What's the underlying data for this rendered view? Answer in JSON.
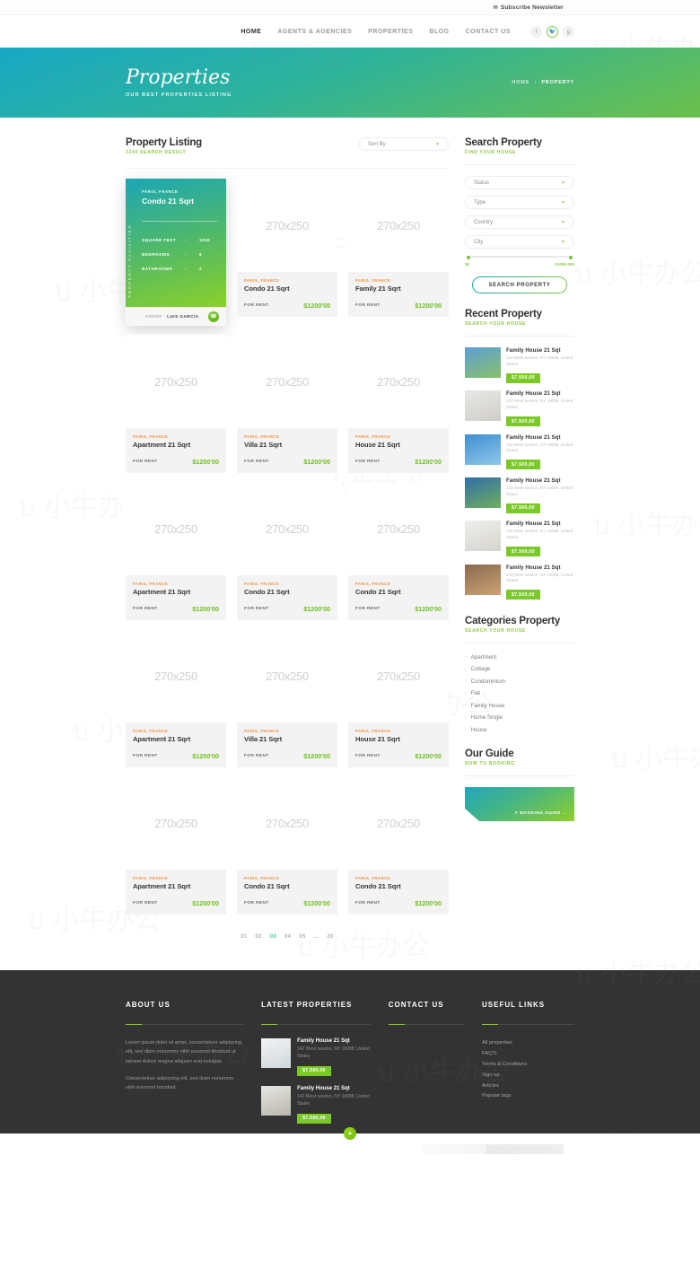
{
  "topbar": {
    "newsletter": "Subscribe Newsletter",
    "mail_icon": "mail-icon"
  },
  "nav": {
    "items": [
      {
        "label": "HOME",
        "active": true
      },
      {
        "label": "AGENTS & AGENCIES",
        "active": false
      },
      {
        "label": "PROPERTIES",
        "active": false
      },
      {
        "label": "BLOG",
        "active": false
      },
      {
        "label": "CONTACT US",
        "active": false
      }
    ],
    "socials": [
      {
        "name": "facebook-icon",
        "glyph": "f",
        "active": false
      },
      {
        "name": "twitter-icon",
        "glyph": "✓",
        "active": true
      },
      {
        "name": "google-plus-icon",
        "glyph": "g",
        "active": false
      }
    ]
  },
  "hero": {
    "title": "Properties",
    "subtitle": "OUR BEST PROPERTIES LISTING",
    "breadcrumb_home": "HOME",
    "breadcrumb_sep": "›",
    "breadcrumb_current": "PROPERTY"
  },
  "listing": {
    "title": "Property Listing",
    "subtitle": "1240 SEARCH RESULT",
    "sort_label": "Sort By",
    "placeholder_text": "270x250",
    "rent_label": "FOR RENT",
    "location": "PARIS, FRANCE",
    "price": "$1200'00",
    "featured": {
      "location": "PARIS, FRANCE",
      "title": "Condo 21 Sqrt",
      "vertical_label": "PROPERTY FACILITIES",
      "facilities": [
        {
          "label": "SQUARE FEET",
          "value": "1200"
        },
        {
          "label": "BEDROOMS",
          "value": "6"
        },
        {
          "label": "BATHROOMS",
          "value": "2"
        }
      ],
      "agent_label": "AGENT :",
      "agent_name": "LUIS GARCIA",
      "phone_icon": "phone-icon"
    },
    "cards": [
      {
        "title": "Condo 21 Sqrt"
      },
      {
        "title": "Family 21 Sqrt"
      },
      {
        "title": "Apartment 21 Sqrt"
      },
      {
        "title": "Villa 21 Sqrt"
      },
      {
        "title": "House 21 Sqrt"
      },
      {
        "title": "Apartment 21 Sqrt"
      },
      {
        "title": "Condo 21 Sqrt"
      },
      {
        "title": "Condo 21 Sqrt"
      },
      {
        "title": "Apartment 21 Sqrt"
      },
      {
        "title": "Villa 21 Sqrt"
      },
      {
        "title": "House 21 Sqrt"
      },
      {
        "title": "Apartment 21 Sqrt"
      },
      {
        "title": "Condo 21 Sqrt"
      },
      {
        "title": "Condo 21 Sqrt"
      }
    ],
    "pagination": [
      {
        "label": "01",
        "active": false
      },
      {
        "label": "02",
        "active": false
      },
      {
        "label": "03",
        "active": true
      },
      {
        "label": "04",
        "active": false
      },
      {
        "label": "05",
        "active": false
      },
      {
        "label": "...",
        "active": false
      },
      {
        "label": "20",
        "active": false
      }
    ]
  },
  "search_property": {
    "title": "Search Property",
    "subtitle": "FIND YOUR HOUSE",
    "fields": [
      {
        "label": "Status"
      },
      {
        "label": "Type"
      },
      {
        "label": "Country"
      },
      {
        "label": "City"
      }
    ],
    "price_min": "$0",
    "price_max": "$1000 000",
    "button": "SEARCH PROPERTY"
  },
  "recent_property": {
    "title": "Recent Property",
    "subtitle": "SEARCH YOUR HOUSE",
    "items": [
      {
        "title": "Family House 21 Sqt",
        "address": "142 West newton, NY 19088, United States",
        "price": "$7.500,00"
      },
      {
        "title": "Family House 21 Sqt",
        "address": "142 West newton, NY 19088, United States",
        "price": "$7.500,00"
      },
      {
        "title": "Family House 21 Sqt",
        "address": "142 West newton, NY 19088, United States",
        "price": "$7.500,00"
      },
      {
        "title": "Family House 21 Sqt",
        "address": "142 West newton, NY 19088, United States",
        "price": "$7.500,00"
      },
      {
        "title": "Family House 21 Sqt",
        "address": "142 West newton, NY 19088, United States",
        "price": "$7.500,00"
      },
      {
        "title": "Family House 21 Sqt",
        "address": "142 West newton, NY 19088, United States",
        "price": "$7.500,00"
      }
    ]
  },
  "categories": {
    "title": "Categories Property",
    "subtitle": "SEARCH YOUR HOUSE",
    "items": [
      {
        "label": "Apartment"
      },
      {
        "label": "Cottage"
      },
      {
        "label": "Condominium"
      },
      {
        "label": "Flat"
      },
      {
        "label": "Family House"
      },
      {
        "label": "Home Single"
      },
      {
        "label": "House"
      }
    ]
  },
  "guide": {
    "title": "Our Guide",
    "subtitle": "HOW TO BOOKING",
    "banner_text": "↗ BOOKING GUIDE →"
  },
  "footer": {
    "about": {
      "heading": "ABOUT US",
      "paragraph1": "Lorem ipsum dolor sit amet, consectetuer adipiscing elit, sed diam nonummy nibh euismod tincidunt ut laoreet dolore magna aliquam erat volutpat.",
      "paragraph2": "Consectetuer adipiscing elit, sed diam nonummy nibh euismod tincidunt"
    },
    "latest": {
      "heading": "LATEST PROPERTIES",
      "items": [
        {
          "title": "Family House 21 Sqt",
          "address": "142 West newton, NY 19088, United States",
          "price": "$7.500,00"
        },
        {
          "title": "Family House 21 Sqt",
          "address": "142 West newton, NY 19088, United States",
          "price": "$7.500,00"
        }
      ]
    },
    "contact": {
      "heading": "CONTACT US"
    },
    "useful": {
      "heading": "USEFUL LINKS",
      "items": [
        {
          "label": "All properties"
        },
        {
          "label": "FAQ'S"
        },
        {
          "label": "Terms & Conditions"
        },
        {
          "label": "Sign up"
        },
        {
          "label": "Articles"
        },
        {
          "label": "Popular tags"
        }
      ]
    },
    "to_top_icon": "chevron-up-icon"
  },
  "colors": {
    "green": "#8dc63f",
    "teal": "#17a8c4",
    "orange": "#f0903a",
    "price_green": "#6fbf1f",
    "badge_green": "#7bc928",
    "footer_bg": "#333333"
  }
}
